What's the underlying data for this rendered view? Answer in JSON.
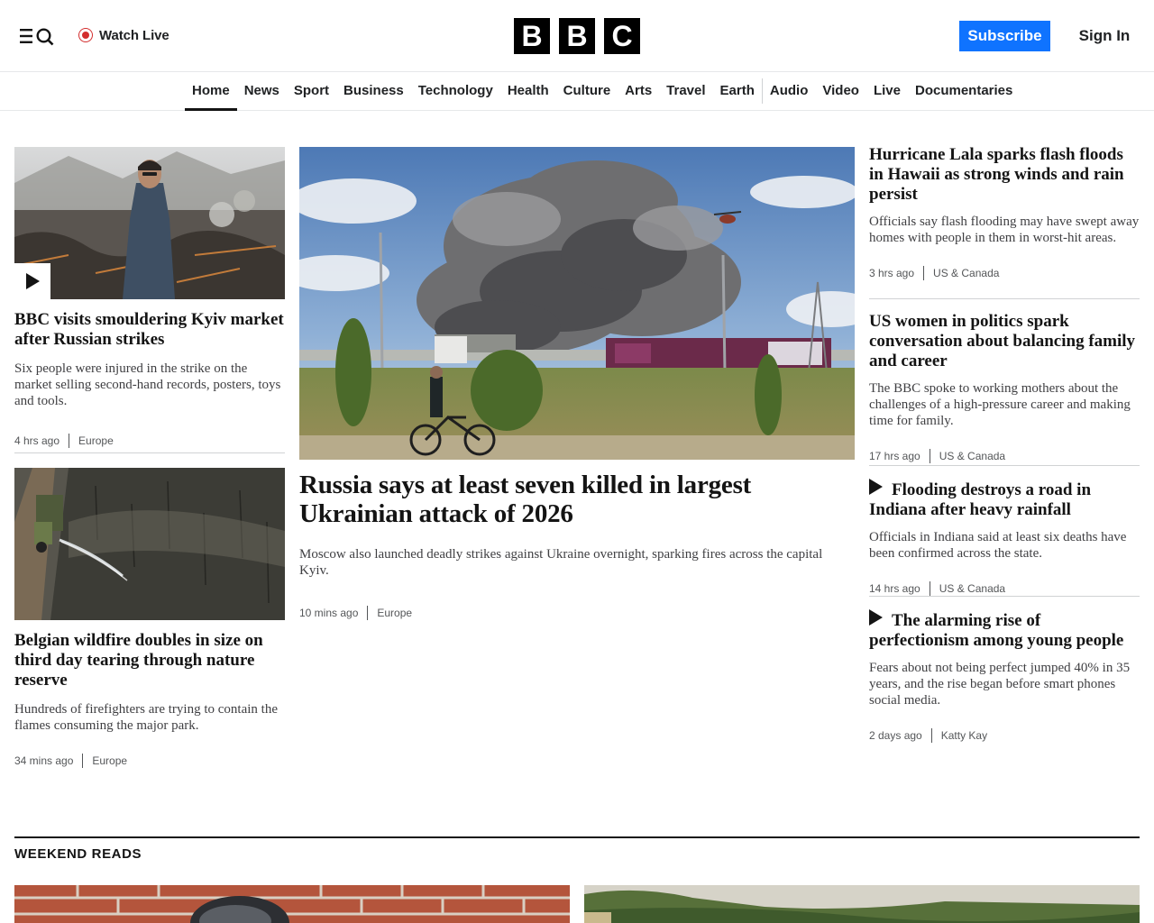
{
  "header": {
    "watch_live": "Watch Live",
    "logo_letters": [
      "B",
      "B",
      "C"
    ],
    "subscribe": "Subscribe",
    "sign_in": "Sign In"
  },
  "nav": {
    "items": [
      "Home",
      "News",
      "Sport",
      "Business",
      "Technology",
      "Health",
      "Culture",
      "Arts",
      "Travel",
      "Earth",
      "Audio",
      "Video",
      "Live",
      "Documentaries"
    ],
    "active": "Home"
  },
  "stories": {
    "left1": {
      "headline": "BBC visits smouldering Kyiv market after Russian strikes",
      "summary": "Six people were injured in the strike on the market selling second-hand records, posters, toys and tools.",
      "time": "4 hrs ago",
      "section": "Europe",
      "has_video": true,
      "image_icon": "kyiv-market-photo"
    },
    "left2": {
      "headline": "Belgian wildfire doubles in size on third day tearing through nature reserve",
      "summary": "Hundreds of firefighters are trying to contain the flames consuming the major park.",
      "time": "34 mins ago",
      "section": "Europe",
      "image_icon": "wildfire-photo"
    },
    "main": {
      "headline": "Russia says at least seven killed in largest Ukrainian attack of 2026",
      "summary": "Moscow also launched deadly strikes against Ukraine overnight, sparking fires across the capital Kyiv.",
      "time": "10 mins ago",
      "section": "Europe",
      "image_icon": "smoke-over-warehouse-photo"
    },
    "right1": {
      "headline": "Hurricane Lala sparks flash floods in Hawaii as strong winds and rain persist",
      "summary": "Officials say flash flooding may have swept away homes with people in them in worst-hit areas.",
      "time": "3 hrs ago",
      "section": "US & Canada"
    },
    "right2": {
      "headline": "US women in politics spark conversation about balancing family and career",
      "summary": "The BBC spoke to working mothers about the challenges of a high-pressure career and making time for family.",
      "time": "17 hrs ago",
      "section": "US & Canada"
    },
    "right3": {
      "headline": "Flooding destroys a road in Indiana after heavy rainfall",
      "summary": "Officials in Indiana said at least six deaths have been confirmed across the state.",
      "time": "14 hrs ago",
      "section": "US & Canada",
      "has_video": true
    },
    "right4": {
      "headline": "The alarming rise of perfectionism among young people",
      "summary": "Fears about not being perfect jumped 40% in 35 years, and the rise began before smart phones social media.",
      "time": "2 days ago",
      "section": "Katty Kay",
      "has_video": true
    }
  },
  "weekend": {
    "title": "WEEKEND READS"
  },
  "colors": {
    "accent_blue": "#0f73ff",
    "live_red": "#d32e2e",
    "text": "#141414"
  }
}
